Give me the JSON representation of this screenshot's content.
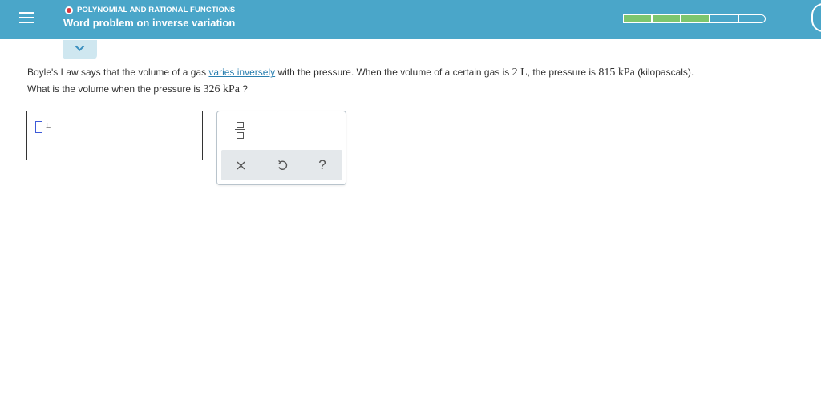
{
  "header": {
    "topic": "POLYNOMIAL AND RATIONAL FUNCTIONS",
    "title": "Word problem on inverse variation",
    "progress": {
      "completed": 3,
      "total": 5
    }
  },
  "question": {
    "text1": "Boyle's Law says that the volume of a gas ",
    "link": "varies inversely",
    "text2": " with the pressure. When the volume of a certain gas is ",
    "v1": "2 L",
    "text3": ", the pressure is ",
    "p1": "815 kPa",
    "text4": " (kilopascals).",
    "line2a": "What is the volume when the pressure is ",
    "p2": "326 kPa",
    "line2b": " ?"
  },
  "answer": {
    "value": "",
    "unit": "L"
  },
  "keypad": {
    "help_label": "?"
  },
  "icons": [
    "menu-icon",
    "chevron-down-icon",
    "fraction-icon",
    "clear-icon",
    "undo-icon",
    "help-icon"
  ],
  "colors": {
    "header": "#4aa6c9",
    "progress_done": "#7dc66e",
    "link": "#2a7fb0",
    "topic_dot": "#d9363e"
  }
}
